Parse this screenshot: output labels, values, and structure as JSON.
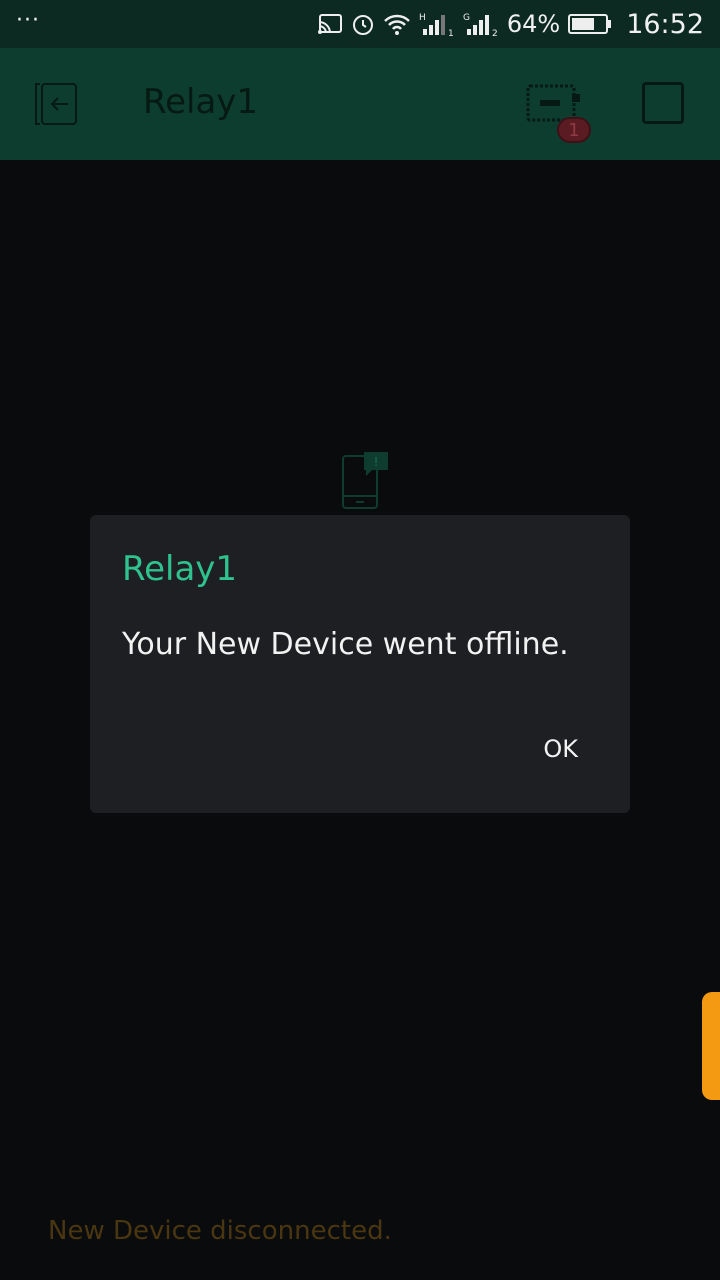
{
  "status_bar": {
    "overflow": "···",
    "battery_percent": "64%",
    "time": "16:52",
    "icons": [
      "cast-icon",
      "alarm-icon",
      "wifi-icon",
      "signal-h-icon",
      "signal-g-icon",
      "battery-icon"
    ]
  },
  "app_bar": {
    "title": "Relay1",
    "device_badge": "1",
    "icons": [
      "back-icon",
      "device-icon",
      "stop-icon"
    ]
  },
  "dialog": {
    "title": "Relay1",
    "message": "Your New Device went offline.",
    "ok_label": "OK"
  },
  "toast": {
    "text": "New Device disconnected."
  },
  "colors": {
    "status_bar": "#0c2a22",
    "app_bar": "#0d3d2f",
    "background": "#0a0b0c",
    "dialog": "#1e1f22",
    "dialog_title": "#2fc28e",
    "side_handle": "#f39a12",
    "toast_text": "#4a3711"
  }
}
